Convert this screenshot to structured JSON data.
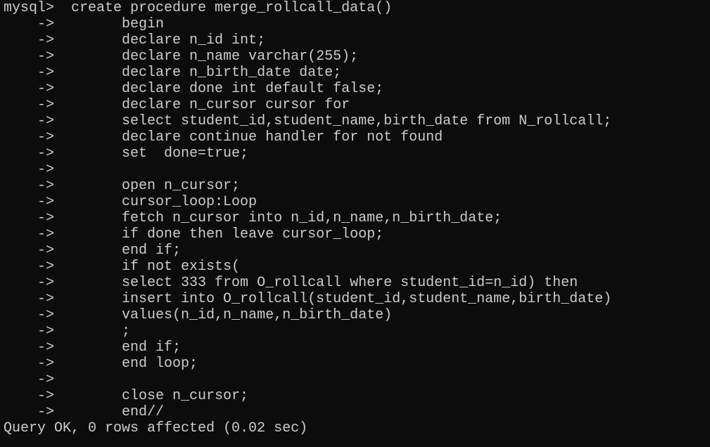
{
  "terminal": {
    "lines": [
      {
        "prompt": "mysql>  ",
        "text": "create procedure merge_rollcall_data()"
      },
      {
        "prompt": "    ->        ",
        "text": "begin"
      },
      {
        "prompt": "    ->        ",
        "text": "declare n_id int;"
      },
      {
        "prompt": "    ->        ",
        "text": "declare n_name varchar(255);"
      },
      {
        "prompt": "    ->        ",
        "text": "declare n_birth_date date;"
      },
      {
        "prompt": "    ->        ",
        "text": "declare done int default false;"
      },
      {
        "prompt": "    ->        ",
        "text": "declare n_cursor cursor for"
      },
      {
        "prompt": "    ->        ",
        "text": "select student_id,student_name,birth_date from N_rollcall;"
      },
      {
        "prompt": "    ->        ",
        "text": "declare continue handler for not found"
      },
      {
        "prompt": "    ->        ",
        "text": "set  done=true;"
      },
      {
        "prompt": "    ->",
        "text": ""
      },
      {
        "prompt": "    ->        ",
        "text": "open n_cursor;"
      },
      {
        "prompt": "    ->        ",
        "text": "cursor_loop:Loop"
      },
      {
        "prompt": "    ->        ",
        "text": "fetch n_cursor into n_id,n_name,n_birth_date;"
      },
      {
        "prompt": "    ->        ",
        "text": "if done then leave cursor_loop;"
      },
      {
        "prompt": "    ->        ",
        "text": "end if;"
      },
      {
        "prompt": "    ->        ",
        "text": "if not exists("
      },
      {
        "prompt": "    ->        ",
        "text": "select 333 from O_rollcall where student_id=n_id) then"
      },
      {
        "prompt": "    ->        ",
        "text": "insert into O_rollcall(student_id,student_name,birth_date)"
      },
      {
        "prompt": "    ->        ",
        "text": "values(n_id,n_name,n_birth_date)"
      },
      {
        "prompt": "    ->        ",
        "text": ";"
      },
      {
        "prompt": "    ->        ",
        "text": "end if;"
      },
      {
        "prompt": "    ->        ",
        "text": "end loop;"
      },
      {
        "prompt": "    ->",
        "text": ""
      },
      {
        "prompt": "    ->        ",
        "text": "close n_cursor;"
      },
      {
        "prompt": "    ->        ",
        "text": "end//"
      }
    ],
    "result": "Query OK, 0 rows affected (0.02 sec)"
  }
}
